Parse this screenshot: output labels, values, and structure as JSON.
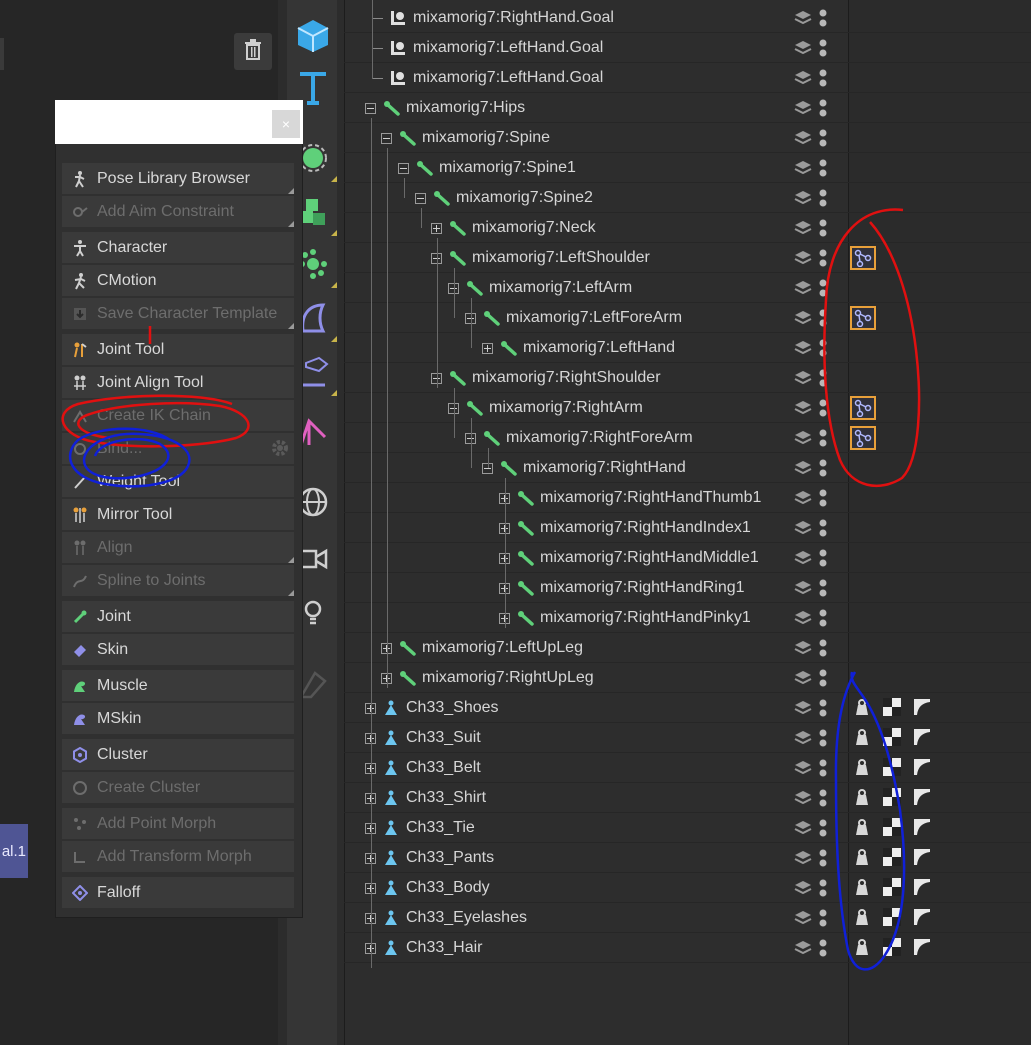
{
  "popup": {
    "close_glyph": "×",
    "items": [
      {
        "label": "Pose Library Browser",
        "disabled": false,
        "icon": "pose-icon",
        "corner": true
      },
      {
        "label": "Add Aim Constraint",
        "disabled": true,
        "icon": "aim-constraint-icon",
        "corner": true
      },
      {
        "label": "Character",
        "disabled": false,
        "icon": "character-icon",
        "corner": false
      },
      {
        "label": "CMotion",
        "disabled": false,
        "icon": "cmotion-icon",
        "corner": false
      },
      {
        "label": "Save Character Template",
        "disabled": true,
        "icon": "save-template-icon",
        "corner": true
      },
      {
        "label": "Joint Tool",
        "disabled": false,
        "icon": "joint-tool-icon",
        "corner": false
      },
      {
        "label": "Joint Align Tool",
        "disabled": false,
        "icon": "joint-align-icon",
        "corner": false
      },
      {
        "label": "Create IK Chain",
        "disabled": true,
        "icon": "ik-chain-icon",
        "corner": false
      },
      {
        "label": "Bind...",
        "disabled": true,
        "icon": "bind-icon",
        "corner": false
      },
      {
        "label": "Weight Tool",
        "disabled": false,
        "icon": "weight-tool-icon",
        "corner": false
      },
      {
        "label": "Mirror Tool",
        "disabled": false,
        "icon": "mirror-tool-icon",
        "corner": false
      },
      {
        "label": "Align",
        "disabled": true,
        "icon": "align-icon",
        "corner": true
      },
      {
        "label": "Spline to Joints",
        "disabled": true,
        "icon": "spline-joints-icon",
        "corner": true
      },
      {
        "label": "Joint",
        "disabled": false,
        "icon": "joint-icon",
        "corner": false
      },
      {
        "label": "Skin",
        "disabled": false,
        "icon": "skin-icon",
        "corner": false
      },
      {
        "label": "Muscle",
        "disabled": false,
        "icon": "muscle-icon",
        "corner": false
      },
      {
        "label": "MSkin",
        "disabled": false,
        "icon": "mskin-icon",
        "corner": false
      },
      {
        "label": "Cluster",
        "disabled": false,
        "icon": "cluster-icon",
        "corner": false
      },
      {
        "label": "Create Cluster",
        "disabled": true,
        "icon": "create-cluster-icon",
        "corner": false
      },
      {
        "label": "Add Point Morph",
        "disabled": true,
        "icon": "point-morph-icon",
        "corner": false
      },
      {
        "label": "Add Transform Morph",
        "disabled": true,
        "icon": "transform-morph-icon",
        "corner": false
      },
      {
        "label": "Falloff",
        "disabled": false,
        "icon": "falloff-icon",
        "corner": false
      }
    ]
  },
  "viewport": {
    "object_tag": "al.1"
  },
  "toolbar": {
    "tools": [
      "cube-icon",
      "text-icon",
      "generator-icon",
      "cloner-icon",
      "deformer-icon",
      "deformer-2-icon",
      "field-icon",
      "spline-effector-icon",
      "environment-icon",
      "camera-icon",
      "light-icon",
      "sculpt-icon"
    ]
  },
  "outliner": {
    "rows": [
      {
        "name": "mixamorig7:RightHand.Goal",
        "type": "goal",
        "expander": "none",
        "tags": "none"
      },
      {
        "name": "mixamorig7:LeftHand.Goal",
        "type": "goal",
        "expander": "none",
        "tags": "none"
      },
      {
        "name": "mixamorig7:LeftHand.Goal",
        "type": "goal",
        "expander": "none",
        "tags": "none"
      },
      {
        "name": "mixamorig7:Hips",
        "type": "joint",
        "expander": "minus",
        "tags": "none"
      },
      {
        "name": "mixamorig7:Spine",
        "type": "joint",
        "expander": "minus",
        "tags": "none"
      },
      {
        "name": "mixamorig7:Spine1",
        "type": "joint",
        "expander": "minus",
        "tags": "none"
      },
      {
        "name": "mixamorig7:Spine2",
        "type": "joint",
        "expander": "minus",
        "tags": "none"
      },
      {
        "name": "mixamorig7:Neck",
        "type": "joint",
        "expander": "plus",
        "tags": "none"
      },
      {
        "name": "mixamorig7:LeftShoulder",
        "type": "joint",
        "expander": "minus",
        "tags": "ik"
      },
      {
        "name": "mixamorig7:LeftArm",
        "type": "joint",
        "expander": "minus",
        "tags": "none"
      },
      {
        "name": "mixamorig7:LeftForeArm",
        "type": "joint",
        "expander": "minus",
        "tags": "ik"
      },
      {
        "name": "mixamorig7:LeftHand",
        "type": "joint",
        "expander": "plus",
        "tags": "none"
      },
      {
        "name": "mixamorig7:RightShoulder",
        "type": "joint",
        "expander": "minus",
        "tags": "none"
      },
      {
        "name": "mixamorig7:RightArm",
        "type": "joint",
        "expander": "minus",
        "tags": "ik"
      },
      {
        "name": "mixamorig7:RightForeArm",
        "type": "joint",
        "expander": "minus",
        "tags": "ik"
      },
      {
        "name": "mixamorig7:RightHand",
        "type": "joint",
        "expander": "minus",
        "tags": "none"
      },
      {
        "name": "mixamorig7:RightHandThumb1",
        "type": "joint",
        "expander": "plus",
        "tags": "none"
      },
      {
        "name": "mixamorig7:RightHandIndex1",
        "type": "joint",
        "expander": "plus",
        "tags": "none"
      },
      {
        "name": "mixamorig7:RightHandMiddle1",
        "type": "joint",
        "expander": "plus",
        "tags": "none"
      },
      {
        "name": "mixamorig7:RightHandRing1",
        "type": "joint",
        "expander": "plus",
        "tags": "none"
      },
      {
        "name": "mixamorig7:RightHandPinky1",
        "type": "joint",
        "expander": "plus",
        "tags": "none"
      },
      {
        "name": "mixamorig7:LeftUpLeg",
        "type": "joint",
        "expander": "plus",
        "tags": "none"
      },
      {
        "name": "mixamorig7:RightUpLeg",
        "type": "joint",
        "expander": "plus",
        "tags": "none"
      },
      {
        "name": "Ch33_Shoes",
        "type": "mesh",
        "expander": "plus",
        "tags": "mesh"
      },
      {
        "name": "Ch33_Suit",
        "type": "mesh",
        "expander": "plus",
        "tags": "mesh"
      },
      {
        "name": "Ch33_Belt",
        "type": "mesh",
        "expander": "plus",
        "tags": "mesh"
      },
      {
        "name": "Ch33_Shirt",
        "type": "mesh",
        "expander": "plus",
        "tags": "mesh"
      },
      {
        "name": "Ch33_Tie",
        "type": "mesh",
        "expander": "plus",
        "tags": "mesh"
      },
      {
        "name": "Ch33_Pants",
        "type": "mesh",
        "expander": "plus",
        "tags": "mesh"
      },
      {
        "name": "Ch33_Body",
        "type": "mesh",
        "expander": "plus",
        "tags": "mesh"
      },
      {
        "name": "Ch33_Eyelashes",
        "type": "mesh",
        "expander": "plus",
        "tags": "mesh"
      },
      {
        "name": "Ch33_Hair",
        "type": "mesh",
        "expander": "plus",
        "tags": "mesh"
      }
    ]
  },
  "colors": {
    "joint": "#5fd07a",
    "mesh": "#6cc6f0",
    "ik_tag_border": "#e8a03a",
    "annotation_red": "#e01010",
    "annotation_blue": "#1020d8"
  }
}
